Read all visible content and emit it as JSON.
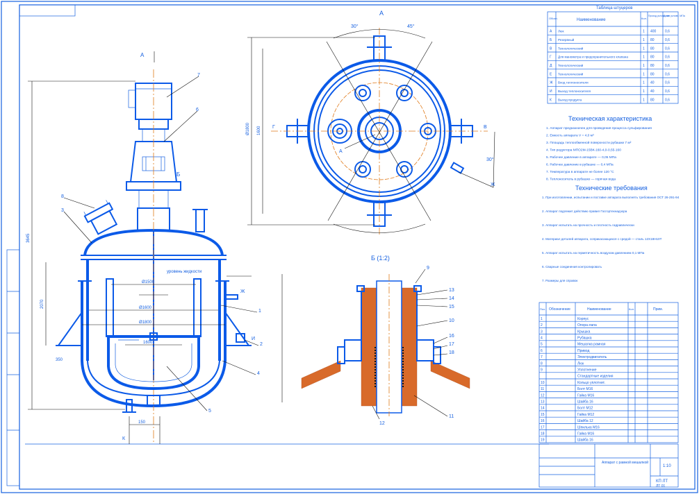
{
  "views": {
    "top_view_label": "А",
    "section_label": "Б (1:2)",
    "arrow_label": "А",
    "callout_b": "Б"
  },
  "nozzle_table": {
    "title": "Таблица штуцеров",
    "headers": [
      "Обозн.",
      "Наименование",
      "Кол.",
      "Проход условн. мм",
      "Давл. условн. МПа"
    ],
    "rows": [
      {
        "mark": "А",
        "name": "Люк",
        "qty": "1",
        "dn": "400",
        "pn": "0,6"
      },
      {
        "mark": "Б",
        "name": "Резервный",
        "qty": "1",
        "dn": "80",
        "pn": "0,6"
      },
      {
        "mark": "В",
        "name": "Технологический",
        "qty": "1",
        "dn": "80",
        "pn": "0,6"
      },
      {
        "mark": "Г",
        "name": "Для манометра и предохранительного клапана",
        "qty": "1",
        "dn": "80",
        "pn": "0,6"
      },
      {
        "mark": "Д",
        "name": "Технологический",
        "qty": "1",
        "dn": "80",
        "pn": "0,6"
      },
      {
        "mark": "Е",
        "name": "Технологический",
        "qty": "1",
        "dn": "80",
        "pn": "0,6"
      },
      {
        "mark": "Ж",
        "name": "Вход теплоносителя",
        "qty": "1",
        "dn": "40",
        "pn": "0,6"
      },
      {
        "mark": "И",
        "name": "Выход теплоносителя",
        "qty": "1",
        "dn": "40",
        "pn": "0,6"
      },
      {
        "mark": "К",
        "name": "Выход продукта",
        "qty": "1",
        "dn": "80",
        "pn": "0,6"
      }
    ]
  },
  "tech_char": {
    "title": "Техническая характеристика",
    "items": [
      "1. Аппарат предназначен для проведения процесса сульфирования",
      "2. Емкость аппарата V = 4,0 м³",
      "3. Площадь теплообменной поверхности рубашки 7 м²",
      "4. Тип редуктора МПО2М-15ВК-160-4,0-0,55-160",
      "5. Рабочее давление в аппарате — 0,05 МПа",
      "6. Рабочее давление в рубашке — 0,4 МПа",
      "7. Температура в аппарате не более 120 °С",
      "8. Теплоноситель в рубашке — горячая вода"
    ]
  },
  "tech_req": {
    "title": "Технические требования",
    "items": [
      "1. При изготовлении, испытании и поставке аппарата выполнять требования ОСТ 26-291-94",
      "2. Аппарат подлежит действию правил Госгортехнадзора",
      "3. Аппарат испытать на прочность и плотность гидравлически",
      "4. Материал деталей аппарата, соприкасающихся с средой — сталь 12Х18Н10Т",
      "5. Аппарат испытать на герметичность воздухом давлением 0,1 МПа",
      "6. Сварные соединения контролировать",
      "7. Размеры для справок"
    ]
  },
  "parts_list": {
    "headers": [
      "Поз.",
      "Обозначение",
      "Наименование",
      "Кол.",
      "Прим."
    ],
    "rows": [
      {
        "pos": "1",
        "name": "Корпус"
      },
      {
        "pos": "2",
        "name": "Опора-лапа"
      },
      {
        "pos": "3",
        "name": "Крышка"
      },
      {
        "pos": "4",
        "name": "Рубашка"
      },
      {
        "pos": "5",
        "name": "Мешалка рамная"
      },
      {
        "pos": "6",
        "name": "Привод"
      },
      {
        "pos": "7",
        "name": "Электродвигатель"
      },
      {
        "pos": "8",
        "name": "Люк"
      },
      {
        "pos": "9",
        "name": "Уплотнение"
      },
      {
        "pos": "",
        "name": "Стандартные изделия"
      },
      {
        "pos": "10",
        "name": "Кольцо уплотнит."
      },
      {
        "pos": "11",
        "name": "Болт М16"
      },
      {
        "pos": "12",
        "name": "Гайка М16"
      },
      {
        "pos": "13",
        "name": "Шайба 16"
      },
      {
        "pos": "14",
        "name": "Болт М12"
      },
      {
        "pos": "15",
        "name": "Гайка М12"
      },
      {
        "pos": "16",
        "name": "Шайба 12"
      },
      {
        "pos": "17",
        "name": "Шпилька М16"
      },
      {
        "pos": "18",
        "name": "Гайка М16"
      },
      {
        "pos": "19",
        "name": "Шайба 16"
      }
    ]
  },
  "title_block": {
    "drawing_title": "Аппарат с рамной мешалкой",
    "scale": "1:10",
    "sheet": "КП ЛТ",
    "code": "ЛТ 01"
  },
  "dims": {
    "d_vessel": "Ø1600",
    "d_mixer": "Ø1500",
    "d_jacket": "Ø1800",
    "h_total": "3645",
    "h_body": "2070",
    "top_dim": "1600",
    "nozzle_k": "150",
    "small": "350",
    "angle1": "30°",
    "angle2": "45°",
    "level": "уровень жидкости"
  },
  "positions": [
    "1",
    "2",
    "3",
    "4",
    "5",
    "6",
    "7",
    "8",
    "9",
    "10",
    "11",
    "12",
    "13",
    "14",
    "15",
    "16",
    "17",
    "18",
    "19"
  ],
  "nozzle_marks": [
    "А",
    "Б",
    "В",
    "Г",
    "Д",
    "Е",
    "Ж",
    "И",
    "К"
  ]
}
